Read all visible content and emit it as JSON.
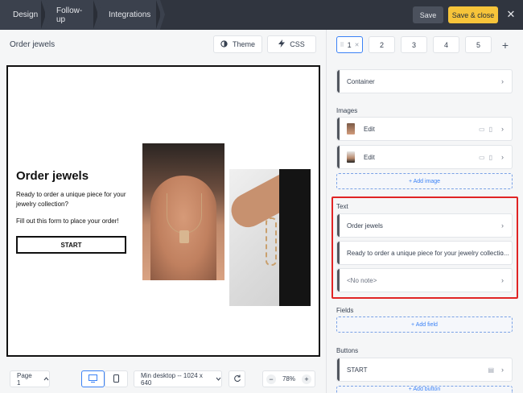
{
  "topbar": {
    "tabs": [
      "Design",
      "Follow-up",
      "Integrations"
    ],
    "save_label": "Save",
    "save_close_label": "Save & close",
    "close_symbol": "✕"
  },
  "editor": {
    "title": "Order jewels",
    "theme_label": "Theme",
    "css_label": "CSS"
  },
  "canvas": {
    "title": "Order jewels",
    "description": "Ready to order a unique piece for your jewelry collection?",
    "note": "Fill out this form to place your order!",
    "button": "START"
  },
  "bottombar": {
    "page_label": "Page 1",
    "size_label": "Min desktop -- 1024 x 640",
    "zoom": "78%",
    "minus": "−",
    "plus": "+"
  },
  "panel": {
    "page_tabs": [
      "1",
      "2",
      "3",
      "4",
      "5"
    ],
    "container_label": "Container",
    "images_heading": "Images",
    "image_items": [
      "Edit",
      "Edit"
    ],
    "add_image": "+ Add image",
    "text_heading": "Text",
    "text_items": [
      "Order jewels",
      "Ready to order a unique piece for your jewelry collectio...",
      "<No note>"
    ],
    "fields_heading": "Fields",
    "add_field": "+ Add field",
    "buttons_heading": "Buttons",
    "button_items": [
      "START"
    ],
    "add_button": "+ Add button"
  },
  "colors": {
    "accent": "#3b82f6",
    "save_close": "#f6c43a",
    "highlight": "#e02424"
  }
}
